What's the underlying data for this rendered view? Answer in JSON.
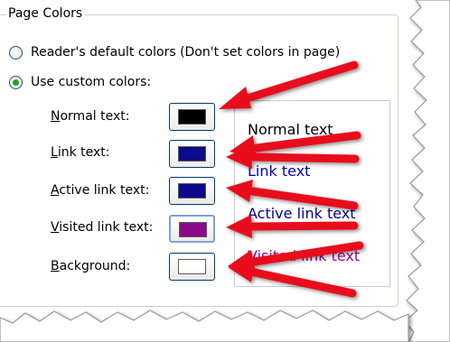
{
  "group": {
    "title": "Page Colors"
  },
  "options": {
    "readers_default": {
      "label": "Reader's default colors (Don't set colors in page)",
      "selected": false
    },
    "custom": {
      "label": "Use custom colors:",
      "selected": true
    }
  },
  "rows": [
    {
      "key": "N",
      "rest": "ormal text:",
      "color": "#000000"
    },
    {
      "key": "L",
      "rest": "ink text:",
      "color": "#0a0a8a"
    },
    {
      "key": "A",
      "rest": "ctive link text:",
      "color": "#0a0a8a"
    },
    {
      "key": "V",
      "rest": "isited link text:",
      "color": "#8a0a8a"
    },
    {
      "key": "B",
      "rest": "ackground:",
      "color": "#ffffff"
    }
  ],
  "preview": {
    "normal": "Normal text",
    "link": "Link text",
    "active": "Active link text",
    "visited": "Visited link text",
    "colors": {
      "normal": "#000000",
      "link": "#0000cc",
      "active": "#000099",
      "visited": "#990099"
    }
  },
  "annotation": {
    "arrow_color": "#e8101a"
  }
}
